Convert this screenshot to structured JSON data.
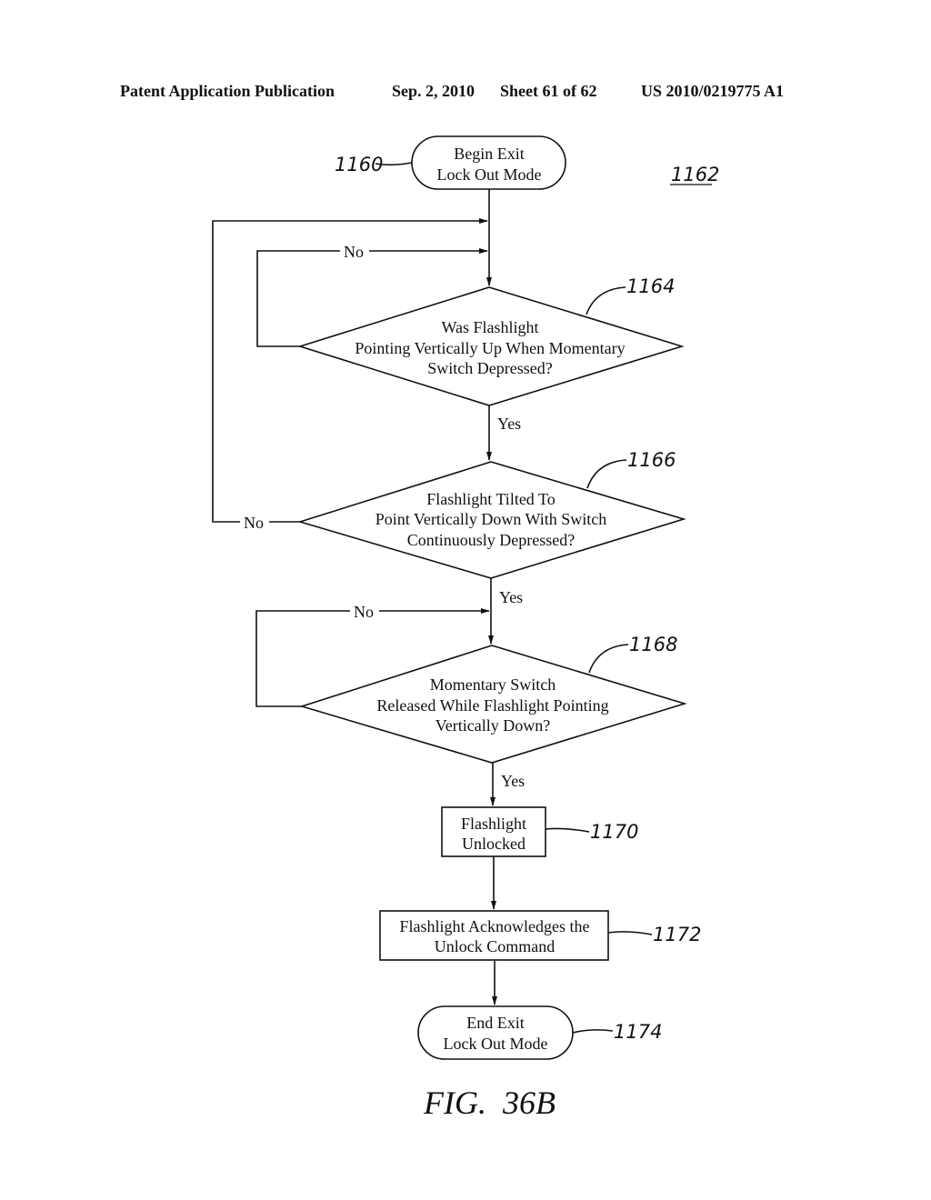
{
  "header": {
    "publication": "Patent Application Publication",
    "date": "Sep. 2, 2010",
    "sheet": "Sheet 61 of 62",
    "number": "US 2010/0219775 A1"
  },
  "diagram_ref": "1162",
  "figure_label": "FIG.  36B",
  "nodes": {
    "start": {
      "ref": "1160",
      "lines": [
        "Begin Exit",
        "Lock Out Mode"
      ]
    },
    "d1164": {
      "ref": "1164",
      "lines": [
        "Was Flashlight",
        "Pointing Vertically Up When Momentary",
        "Switch Depressed?"
      ]
    },
    "d1166": {
      "ref": "1166",
      "lines": [
        "Flashlight Tilted To",
        "Point Vertically Down With Switch",
        "Continuously Depressed?"
      ]
    },
    "d1168": {
      "ref": "1168",
      "lines": [
        "Momentary Switch",
        "Released While Flashlight Pointing",
        "Vertically Down?"
      ]
    },
    "p1170": {
      "ref": "1170",
      "lines": [
        "Flashlight",
        "Unlocked"
      ]
    },
    "p1172": {
      "ref": "1172",
      "lines": [
        "Flashlight Acknowledges the",
        "Unlock Command"
      ]
    },
    "end": {
      "ref": "1174",
      "lines": [
        "End Exit",
        "Lock Out Mode"
      ]
    }
  },
  "edge_labels": {
    "no_1164": "No",
    "yes_1164": "Yes",
    "no_1166": "No",
    "yes_1166": "Yes",
    "no_1168": "No",
    "yes_1168": "Yes"
  }
}
